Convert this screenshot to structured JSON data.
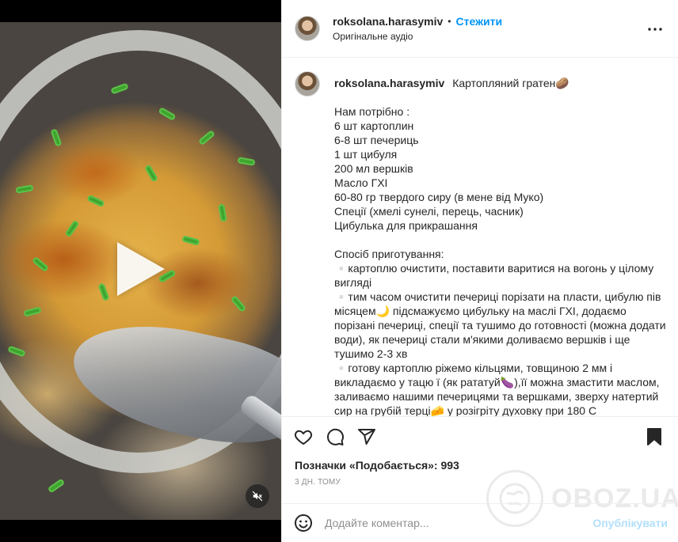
{
  "header": {
    "username": "roksolana.harasymiv",
    "separator": "•",
    "follow_label": "Стежити",
    "audio_label": "Оригінальне аудіо"
  },
  "caption": {
    "username": "roksolana.harasymiv",
    "title": "Картопляний гратен🥔",
    "lines": [
      "Нам потрібно :",
      "6 шт картоплин",
      "6-8 шт печериць",
      "1 шт цибуля",
      "200 мл вершків",
      "Масло ГХІ",
      "60-80 гр твердого сиру (в мене від Муко)",
      "Спеції (хмелі сунелі, перець, часник)",
      "Цибулька для прикрашання",
      "",
      "Спосіб приготування:",
      "▫️картоплю очистити, поставити варитися на вогонь у цілому вигляді",
      "▫️тим часом очистити печериці порізати на пласти, цибулю пів місяцем🌙 підсмажуємо цибульку на маслі ГХІ, додаємо порізані печериці, спеції та тушимо до готовності (можна додати води), як печериці стали м'якими доливаємо вершків і ще тушимо 2-3 хв",
      "▫️готову картоплю ріжемо кільцями, товщиною 2 мм і викладаємо у тацю ї (як рататуй🍆),її можна змастити маслом, заливаємо нашими печерицями та вершками, зверху натертий сир на грубій терці🧀 у розігріту духовку при 180 С"
    ]
  },
  "likes": {
    "text": "Позначки «Подобається»: 993"
  },
  "time": {
    "text": "3 ДН. ТОМУ"
  },
  "comment": {
    "placeholder": "Додайте коментар...",
    "publish_label": "Опублікувати"
  },
  "watermark": {
    "text": "OBOZ.UA"
  },
  "icons": {
    "more": "more-options-icon",
    "like": "heart-icon",
    "comment": "comment-icon",
    "share": "share-icon",
    "save": "bookmark-icon",
    "emoji": "emoji-icon",
    "play": "play-icon",
    "mute": "muted-speaker-icon"
  },
  "colors": {
    "accent": "#0095f6",
    "publish_disabled": "#b2dffc",
    "text": "#262626",
    "muted": "#8e8e8e"
  }
}
